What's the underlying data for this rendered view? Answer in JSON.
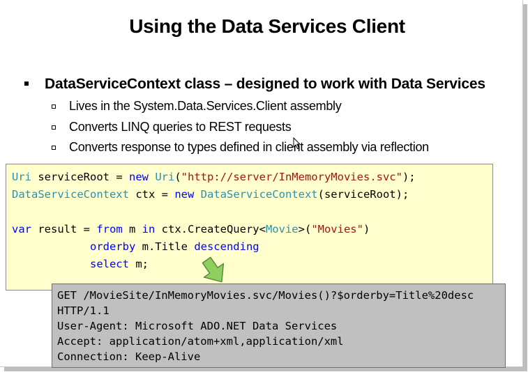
{
  "slide": {
    "title": "Using the Data Services Client",
    "main_bullet": "DataServiceContext class – designed to work with Data Services",
    "sub_bullets": [
      "Lives in the System.Data.Services.Client assembly",
      "Converts LINQ queries to REST requests",
      "Converts response to types defined in client assembly via reflection"
    ]
  },
  "code": {
    "line1": {
      "type": "Uri",
      "a": " serviceRoot = ",
      "kw": "new",
      "b": " ",
      "type2": "Uri",
      "c": "(",
      "str": "\"http://server/InMemoryMovies.svc\"",
      "d": ");"
    },
    "line2": {
      "type": "DataServiceContext",
      "a": " ctx = ",
      "kw": "new",
      "b": " ",
      "type2": "DataServiceContext",
      "c": "(serviceRoot);"
    },
    "line3": {
      "kw1": "var",
      "a": " result = ",
      "kw2": "from",
      "b": " m ",
      "kw3": "in",
      "c": " ctx.CreateQuery<",
      "type": "Movie",
      "d": ">(",
      "str": "\"Movies\"",
      "e": ")"
    },
    "line4": {
      "indent": "            ",
      "kw1": "orderby",
      "a": " m.Title ",
      "kw2": "descending"
    },
    "line5": {
      "indent": "            ",
      "kw": "select",
      "a": " m;"
    }
  },
  "http_request": [
    "GET /MovieSite/InMemoryMovies.svc/Movies()?$orderby=Title%20desc",
    "HTTP/1.1",
    "User-Agent: Microsoft ADO.NET Data Services",
    "Accept: application/atom+xml,application/xml",
    "Connection: Keep-Alive"
  ],
  "colors": {
    "code_background": "#ffffcd",
    "http_background": "#c0c0c0",
    "type": "#2b91af",
    "keyword": "#0000ff",
    "string": "#a31515",
    "arrow": "#8fce5f"
  }
}
